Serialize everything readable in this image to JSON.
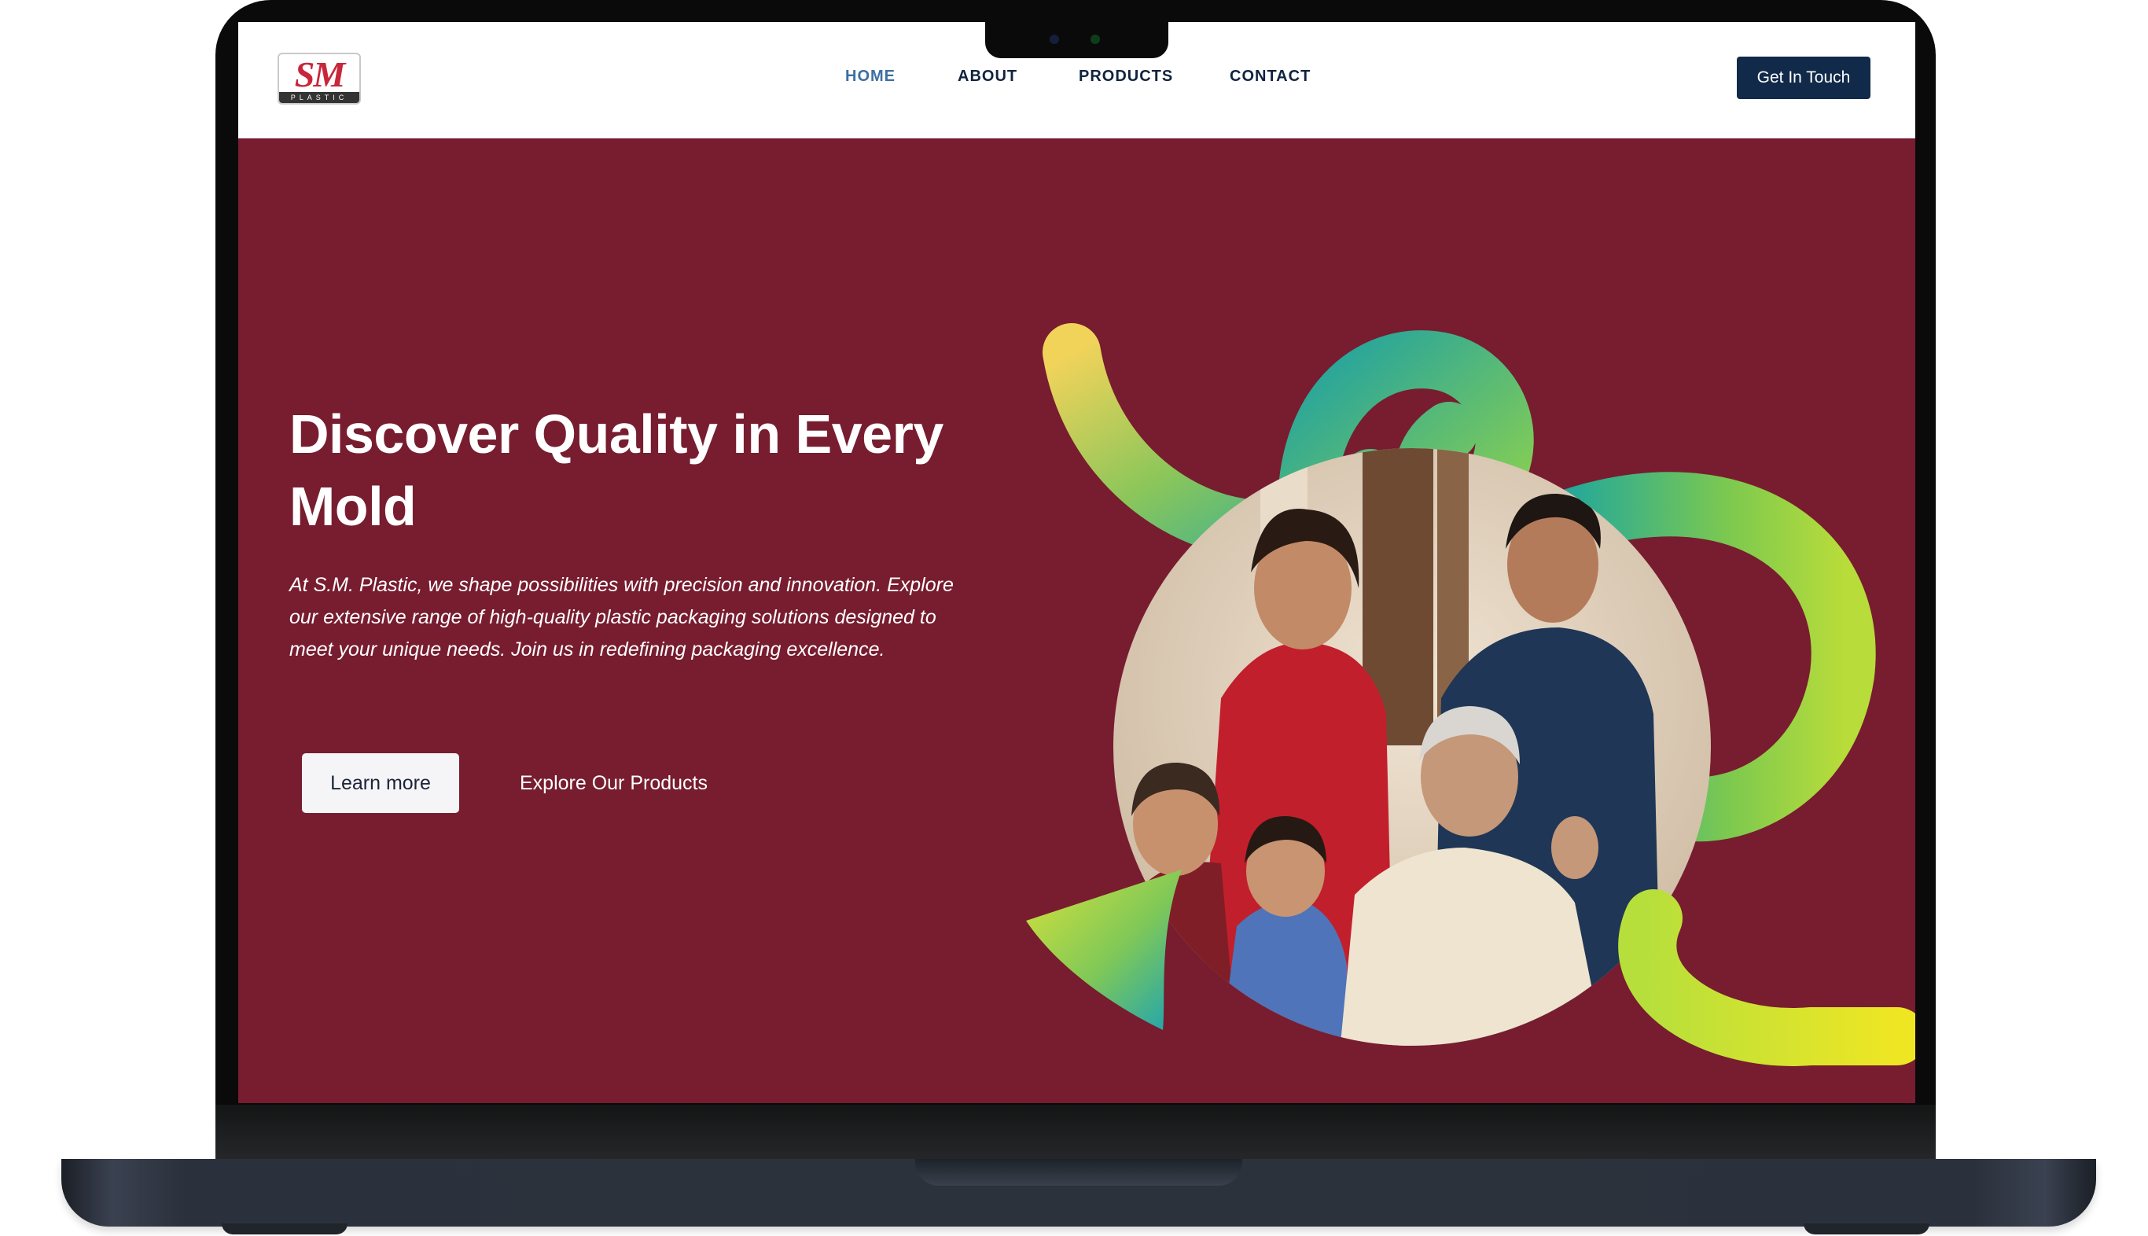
{
  "brand": {
    "logo_text": "SM",
    "logo_subtext": "PLASTIC"
  },
  "nav": {
    "items": [
      {
        "label": "HOME",
        "active": true
      },
      {
        "label": "ABOUT",
        "active": false
      },
      {
        "label": "PRODUCTS",
        "active": false
      },
      {
        "label": "CONTACT",
        "active": false
      }
    ],
    "cta_label": "Get In Touch"
  },
  "hero": {
    "title": "Discover Quality in Every Mold",
    "description": "At S.M. Plastic, we shape possibilities with precision and innovation. Explore our extensive range of high-quality plastic packaging solutions designed to meet your unique needs. Join us in redefining packaging excellence.",
    "primary_button": "Learn more",
    "secondary_link": "Explore Our Products",
    "image_subject": "family-photo"
  },
  "colors": {
    "hero_background": "#771d2f",
    "nav_active": "#3d6fa2",
    "nav_text": "#10233f",
    "cta_background": "#112a4a",
    "brand_red": "#c8273b"
  }
}
